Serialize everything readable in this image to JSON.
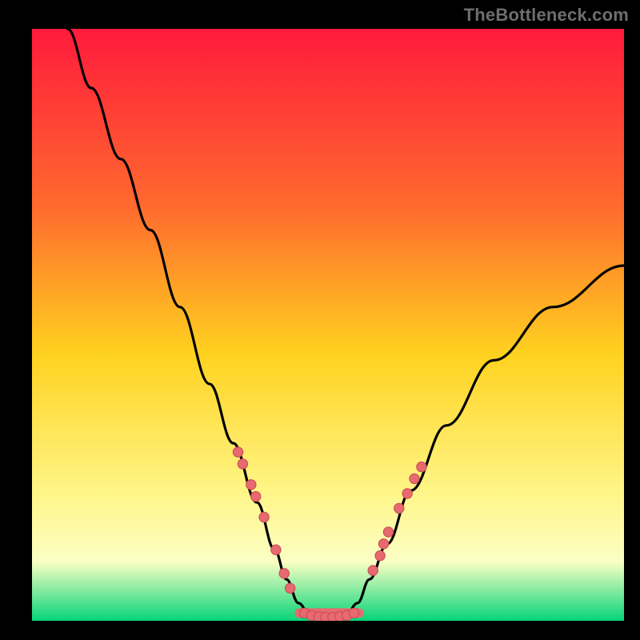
{
  "watermark": "TheBottleneck.com",
  "colors": {
    "bg_black": "#000000",
    "grad_top": "#ff1a3c",
    "grad_mid1": "#ff6a2e",
    "grad_mid2": "#ffd21f",
    "grad_mid3": "#fff586",
    "grad_mid4": "#fcffc4",
    "grad_bottom": "#05d57a",
    "curve": "#000000",
    "marker_fill": "#e66a6f",
    "marker_stroke": "#c94a50"
  },
  "chart_data": {
    "type": "line",
    "title": "",
    "xlabel": "",
    "ylabel": "",
    "xlim": [
      0,
      100
    ],
    "ylim": [
      0,
      100
    ],
    "series": [
      {
        "name": "bottleneck-curve",
        "x": [
          6,
          10,
          15,
          20,
          25,
          30,
          34,
          38,
          41,
          43,
          45,
          47,
          49,
          51,
          53,
          55,
          57,
          60,
          64,
          70,
          78,
          88,
          100
        ],
        "y": [
          100,
          90,
          78,
          66,
          53,
          40,
          30,
          20,
          12,
          7,
          3,
          1,
          0.5,
          0.5,
          1,
          3,
          7,
          13,
          22,
          33,
          44,
          53,
          60
        ]
      }
    ],
    "markers_left": [
      {
        "x": 34.8,
        "y": 28.5
      },
      {
        "x": 35.6,
        "y": 26.5
      },
      {
        "x": 37.0,
        "y": 23.0
      },
      {
        "x": 37.8,
        "y": 21.0
      },
      {
        "x": 39.2,
        "y": 17.5
      },
      {
        "x": 41.2,
        "y": 12.0
      },
      {
        "x": 42.6,
        "y": 8.0
      },
      {
        "x": 43.6,
        "y": 5.5
      }
    ],
    "markers_bottom": [
      {
        "x": 46.0,
        "y": 1.3
      },
      {
        "x": 47.2,
        "y": 0.9
      },
      {
        "x": 48.4,
        "y": 0.7
      },
      {
        "x": 49.6,
        "y": 0.6
      },
      {
        "x": 50.8,
        "y": 0.6
      },
      {
        "x": 52.0,
        "y": 0.7
      },
      {
        "x": 53.2,
        "y": 0.9
      },
      {
        "x": 54.4,
        "y": 1.3
      }
    ],
    "markers_right": [
      {
        "x": 57.6,
        "y": 8.5
      },
      {
        "x": 58.8,
        "y": 11.0
      },
      {
        "x": 59.4,
        "y": 13.0
      },
      {
        "x": 60.2,
        "y": 15.0
      },
      {
        "x": 62.0,
        "y": 19.0
      },
      {
        "x": 63.4,
        "y": 21.5
      },
      {
        "x": 64.6,
        "y": 24.0
      },
      {
        "x": 65.8,
        "y": 26.0
      }
    ]
  }
}
